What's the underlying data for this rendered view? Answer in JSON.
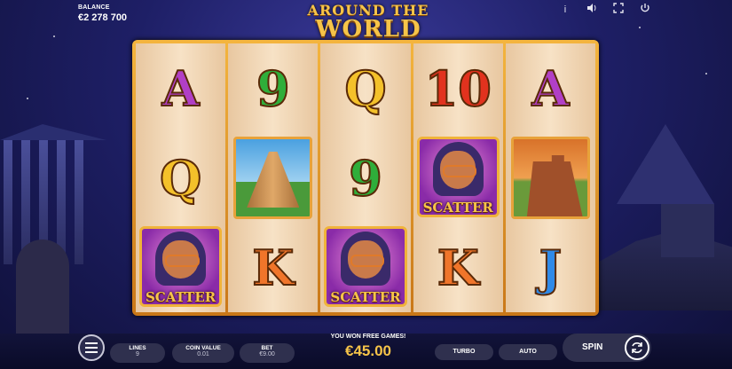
{
  "hud": {
    "balance_label": "BALANCE",
    "balance_value": "€2 278 700",
    "logo_line1": "AROUND THE",
    "logo_line2": "WORLD",
    "icons": [
      "info-icon",
      "sound-icon",
      "fullscreen-icon",
      "power-icon"
    ],
    "info_glyph": "i"
  },
  "reels": [
    [
      {
        "type": "letter",
        "text": "A",
        "color": "purple"
      },
      {
        "type": "letter",
        "text": "Q",
        "color": "gold"
      },
      {
        "type": "scatter",
        "label": "SCATTER"
      }
    ],
    [
      {
        "type": "letter",
        "text": "9",
        "color": "green"
      },
      {
        "type": "image",
        "name": "pyramid"
      },
      {
        "type": "letter",
        "text": "K",
        "color": "orange"
      }
    ],
    [
      {
        "type": "letter",
        "text": "Q",
        "color": "gold"
      },
      {
        "type": "letter",
        "text": "9",
        "color": "green"
      },
      {
        "type": "scatter",
        "label": "SCATTER"
      }
    ],
    [
      {
        "type": "letter",
        "text": "10",
        "color": "red"
      },
      {
        "type": "scatter",
        "label": "SCATTER"
      },
      {
        "type": "letter",
        "text": "K",
        "color": "orange"
      }
    ],
    [
      {
        "type": "letter",
        "text": "A",
        "color": "purple"
      },
      {
        "type": "image",
        "name": "great-wall"
      },
      {
        "type": "letter",
        "text": "J",
        "color": "blue"
      }
    ]
  ],
  "controls": {
    "lines_label": "LINES",
    "lines_value": "9",
    "coin_label": "COIN VALUE",
    "coin_value": "0.01",
    "bet_label": "BET",
    "bet_value": "€9.00",
    "win_message": "YOU WON FREE GAMES!",
    "win_value": "€45.00",
    "turbo_label": "TURBO",
    "auto_label": "AUTO",
    "spin_label": "SPIN"
  },
  "colors": {
    "accent": "#f6c449",
    "purple": "#b13fc6",
    "green": "#2fae3a",
    "gold": "#f4c12a",
    "red": "#e2321e",
    "orange": "#f0752a",
    "blue": "#2f8ae8"
  }
}
